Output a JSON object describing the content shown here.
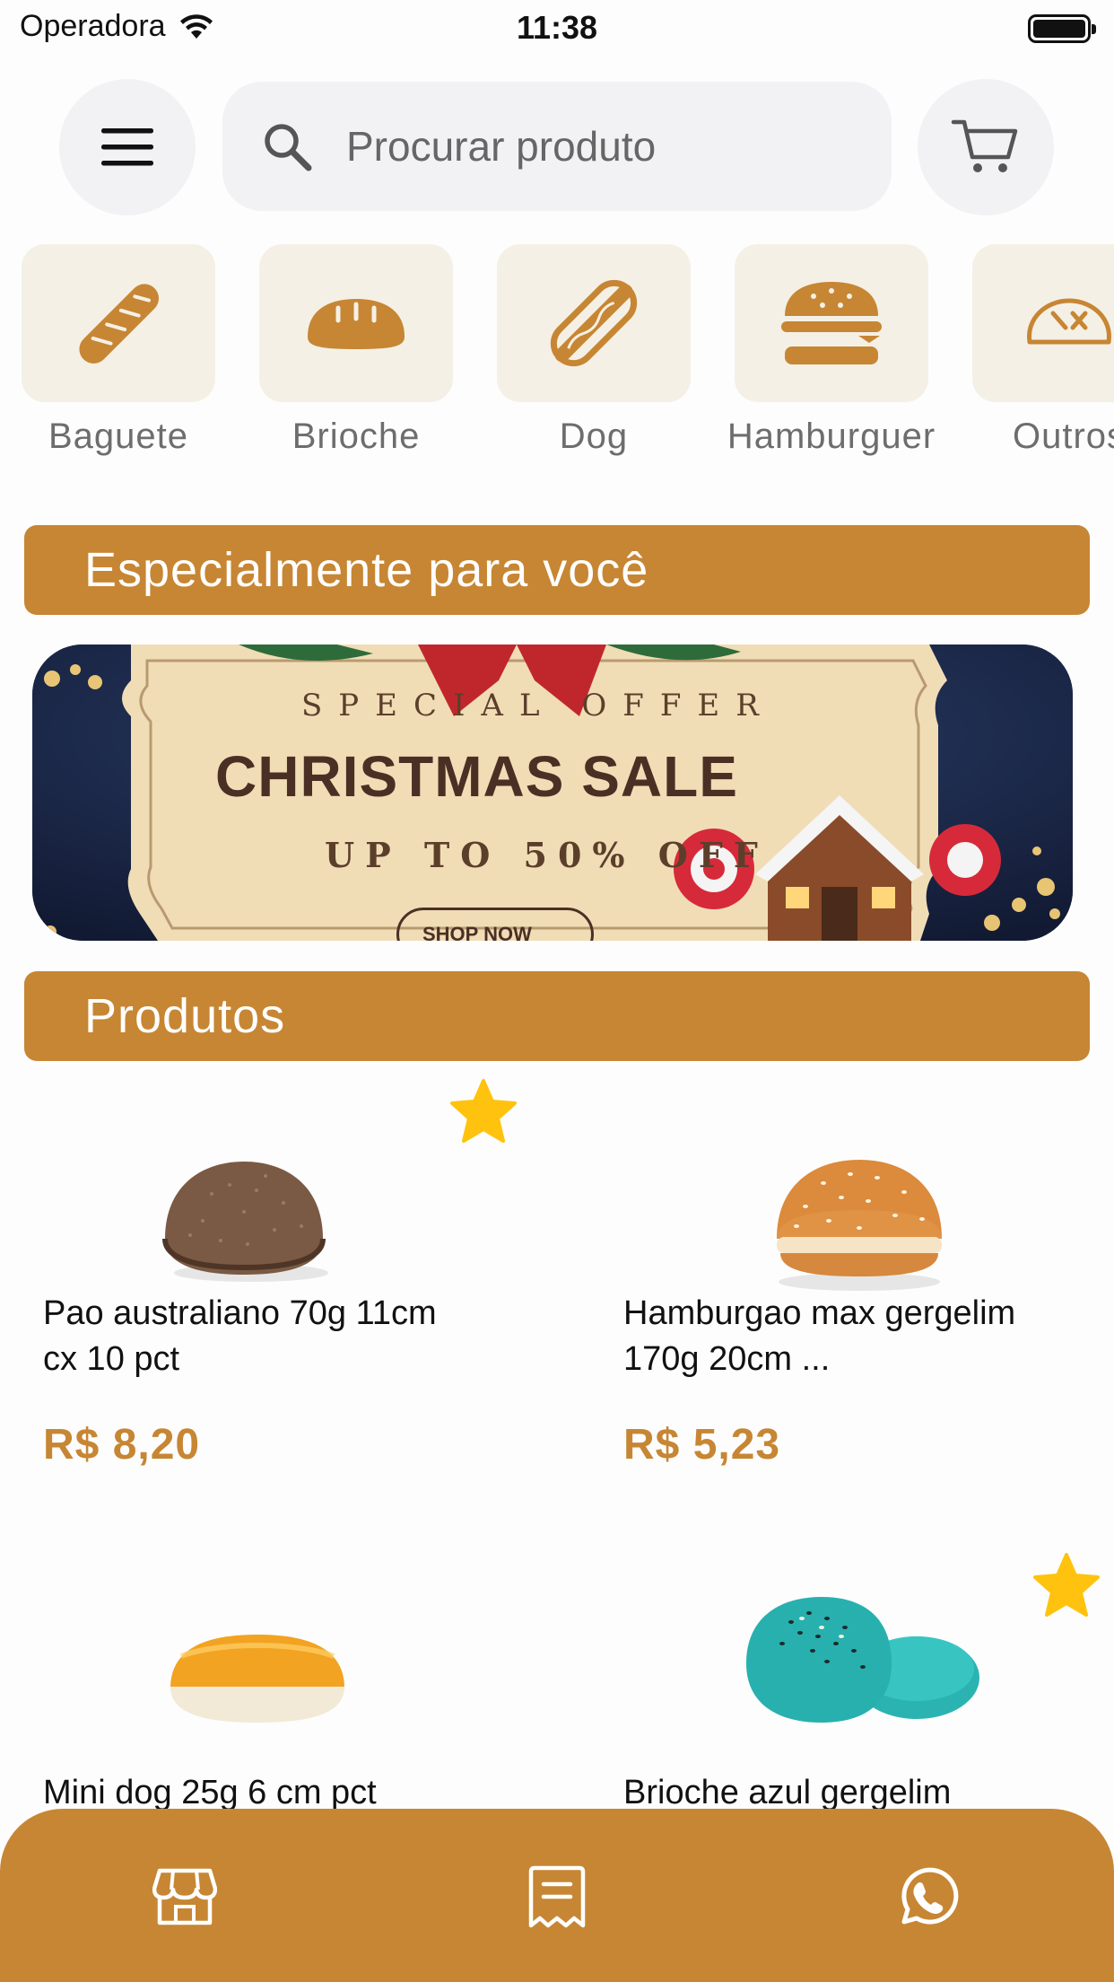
{
  "status_bar": {
    "carrier": "Operadora",
    "time": "11:38"
  },
  "search": {
    "placeholder": "Procurar produto"
  },
  "categories": [
    {
      "label": "Baguete",
      "icon": "baguette-icon"
    },
    {
      "label": "Brioche",
      "icon": "brioche-icon"
    },
    {
      "label": "Dog",
      "icon": "hotdog-icon"
    },
    {
      "label": "Hamburguer",
      "icon": "hamburger-icon"
    },
    {
      "label": "Outros",
      "icon": "bread-loaf-icon"
    }
  ],
  "sections": {
    "featured_title": "Especialmente para você",
    "products_title": "Produtos"
  },
  "promo": {
    "special": "SPECIAL OFFER",
    "title": "CHRISTMAS SALE",
    "subtitle": "UP TO 50% OFF",
    "button": "SHOP NOW"
  },
  "products": [
    {
      "name": "Pao australiano 70g 11cm cx 10 pct",
      "price": "R$ 8,20",
      "favorite": true
    },
    {
      "name": "Hamburgao max gergelim 170g 20cm ...",
      "price": "R$ 5,23",
      "favorite": false
    },
    {
      "name": "Mini dog  25g 6 cm pct",
      "price": "",
      "favorite": false
    },
    {
      "name": "Brioche azul gergelim",
      "price": "",
      "favorite": true
    }
  ],
  "bottom_nav": [
    {
      "icon": "store-icon"
    },
    {
      "icon": "orders-icon"
    },
    {
      "icon": "whatsapp-icon"
    }
  ],
  "colors": {
    "accent": "#c78633",
    "category_tile": "#f5f0e6",
    "star": "#ffc30f",
    "search_bg": "#f2f2f4"
  }
}
